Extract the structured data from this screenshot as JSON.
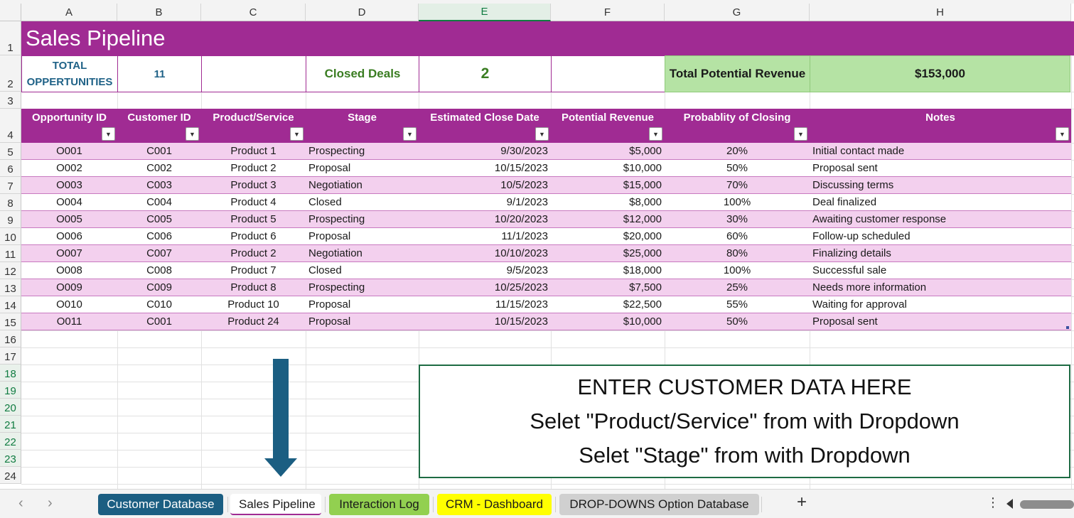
{
  "columns": [
    "A",
    "B",
    "C",
    "D",
    "E",
    "F",
    "G",
    "H"
  ],
  "rows": [
    "1",
    "2",
    "3",
    "4",
    "5",
    "6",
    "7",
    "8",
    "9",
    "10",
    "11",
    "12",
    "13",
    "14",
    "15",
    "16",
    "17",
    "18",
    "19",
    "20",
    "21",
    "22",
    "23",
    "24"
  ],
  "title": "Sales Pipeline",
  "kpi": {
    "total_label": "TOTAL OPPERTUNITIES",
    "total_value": "11",
    "closed_label": "Closed Deals",
    "closed_value": "2",
    "revenue_label": "Total Potential Revenue",
    "revenue_value": "$153,000"
  },
  "headers": [
    "Opportunity ID",
    "Customer ID",
    "Product/Service",
    "Stage",
    "Estimated Close Date",
    "Potential Revenue",
    "Probablity of Closing",
    "Notes"
  ],
  "records": [
    [
      "O001",
      "C001",
      "Product 1",
      "Prospecting",
      "9/30/2023",
      "$5,000",
      "20%",
      "Initial contact made"
    ],
    [
      "O002",
      "C002",
      "Product 2",
      "Proposal",
      "10/15/2023",
      "$10,000",
      "50%",
      "Proposal sent"
    ],
    [
      "O003",
      "C003",
      "Product 3",
      "Negotiation",
      "10/5/2023",
      "$15,000",
      "70%",
      "Discussing terms"
    ],
    [
      "O004",
      "C004",
      "Product 4",
      "Closed",
      "9/1/2023",
      "$8,000",
      "100%",
      "Deal finalized"
    ],
    [
      "O005",
      "C005",
      "Product 5",
      "Prospecting",
      "10/20/2023",
      "$12,000",
      "30%",
      "Awaiting customer response"
    ],
    [
      "O006",
      "C006",
      "Product 6",
      "Proposal",
      "11/1/2023",
      "$20,000",
      "60%",
      "Follow-up scheduled"
    ],
    [
      "O007",
      "C007",
      "Product 2",
      "Negotiation",
      "10/10/2023",
      "$25,000",
      "80%",
      "Finalizing details"
    ],
    [
      "O008",
      "C008",
      "Product 7",
      "Closed",
      "9/5/2023",
      "$18,000",
      "100%",
      "Successful sale"
    ],
    [
      "O009",
      "C009",
      "Product 8",
      "Prospecting",
      "10/25/2023",
      "$7,500",
      "25%",
      "Needs more information"
    ],
    [
      "O010",
      "C010",
      "Product 10",
      "Proposal",
      "11/15/2023",
      "$22,500",
      "55%",
      "Waiting for approval"
    ],
    [
      "O011",
      "C001",
      "Product 24",
      "Proposal",
      "10/15/2023",
      "$10,000",
      "50%",
      "Proposal sent"
    ]
  ],
  "info_box": {
    "line1": "ENTER CUSTOMER DATA HERE",
    "line2": "Selet \"Product/Service\" from with Dropdown",
    "line3": "Selet \"Stage\" from with Dropdown"
  },
  "tabs": [
    {
      "label": "Customer Database",
      "bg": "#1b5e82",
      "fg": "#ffffff"
    },
    {
      "label": "Sales Pipeline",
      "bg": "#ffffff",
      "fg": "#1a1a1a"
    },
    {
      "label": "Interaction Log",
      "bg": "#92d050",
      "fg": "#1a1a1a"
    },
    {
      "label": "CRM - Dashboard",
      "bg": "#ffff00",
      "fg": "#1a1a1a"
    },
    {
      "label": "DROP-DOWNS Option Database",
      "bg": "#d0d0d0",
      "fg": "#1a1a1a"
    }
  ],
  "icons": {
    "prev": "chevron-left-icon",
    "next": "chevron-right-icon",
    "add": "plus-icon",
    "more": "kebab-icon",
    "filter": "filter-dropdown-icon",
    "arrow": "arrow-down-icon"
  },
  "colors": {
    "accent": "#a02b93",
    "row_pink": "#f3d0ee",
    "kpi_green_bg": "#b5e3a4",
    "kpi_blue_text": "#1f6287",
    "kpi_green_text": "#3a7d22",
    "arrow": "#1b5e82"
  }
}
